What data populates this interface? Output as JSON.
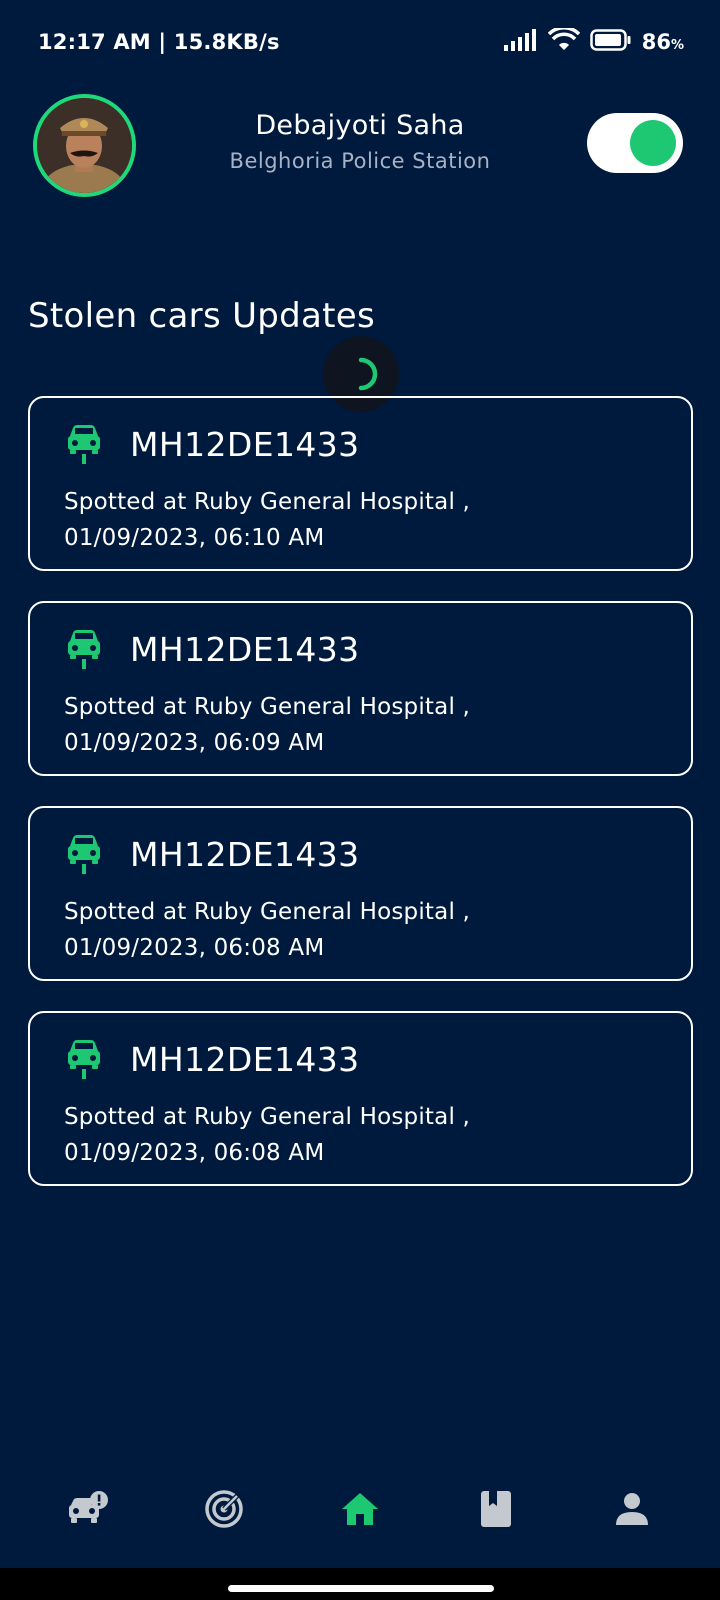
{
  "status_bar": {
    "time_speed": "12:17 AM | 15.8KB/s",
    "battery_level": "86",
    "battery_unit": "%"
  },
  "header": {
    "officer_name": "Debajyoti Saha",
    "station": "Belghoria Police Station",
    "availability_toggle_on": true
  },
  "section": {
    "title": "Stolen cars Updates"
  },
  "updates": [
    {
      "plate": "MH12DE1433",
      "location": "Spotted at Ruby General Hospital ,",
      "datetime": "01/09/2023, 06:10 AM"
    },
    {
      "plate": "MH12DE1433",
      "location": "Spotted at Ruby General Hospital ,",
      "datetime": "01/09/2023, 06:09 AM"
    },
    {
      "plate": "MH12DE1433",
      "location": "Spotted at Ruby General Hospital ,",
      "datetime": "01/09/2023, 06:08 AM"
    },
    {
      "plate": "MH12DE1433",
      "location": "Spotted at Ruby General Hospital ,",
      "datetime": "01/09/2023, 06:08 AM"
    }
  ],
  "nav": {
    "items": [
      {
        "icon": "car-alert-icon",
        "active": false
      },
      {
        "icon": "radar-icon",
        "active": false
      },
      {
        "icon": "home-icon",
        "active": true
      },
      {
        "icon": "bookmark-book-icon",
        "active": false
      },
      {
        "icon": "person-icon",
        "active": false
      }
    ]
  },
  "colors": {
    "background": "#001a3d",
    "accent": "#1ec772",
    "nav_inactive": "#c4c8cf"
  }
}
